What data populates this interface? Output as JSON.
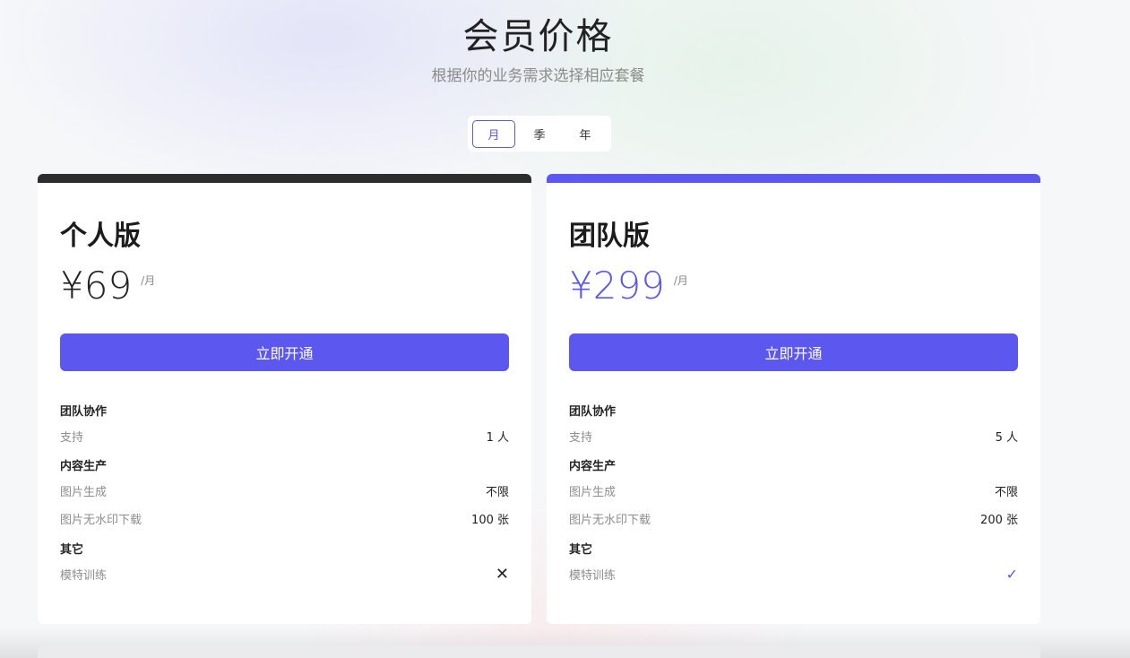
{
  "header": {
    "title": "会员价格",
    "subtitle": "根据你的业务需求选择相应套餐"
  },
  "period_toggle": {
    "options": [
      "月",
      "季",
      "年"
    ],
    "selected": "月"
  },
  "colors": {
    "accent": "#5b57ef",
    "personal_bar": "#2d2d2d"
  },
  "plans": [
    {
      "name": "个人版",
      "price": "¥69",
      "unit": "/月",
      "button": "立即开通",
      "sections": [
        {
          "title": "团队协作",
          "rows": [
            {
              "label": "支持",
              "value": "1 人"
            }
          ]
        },
        {
          "title": "内容生产",
          "rows": [
            {
              "label": "图片生成",
              "value": "不限"
            },
            {
              "label": "图片无水印下载",
              "value": "100 张"
            }
          ]
        },
        {
          "title": "其它",
          "rows": [
            {
              "label": "模特训练",
              "icon": "cross-icon",
              "glyph": "✕"
            }
          ]
        }
      ]
    },
    {
      "name": "团队版",
      "price": "¥299",
      "unit": "/月",
      "button": "立即开通",
      "sections": [
        {
          "title": "团队协作",
          "rows": [
            {
              "label": "支持",
              "value": "5 人"
            }
          ]
        },
        {
          "title": "内容生产",
          "rows": [
            {
              "label": "图片生成",
              "value": "不限"
            },
            {
              "label": "图片无水印下载",
              "value": "200 张"
            }
          ]
        },
        {
          "title": "其它",
          "rows": [
            {
              "label": "模特训练",
              "icon": "check-icon",
              "glyph": "✓"
            }
          ]
        }
      ]
    }
  ]
}
